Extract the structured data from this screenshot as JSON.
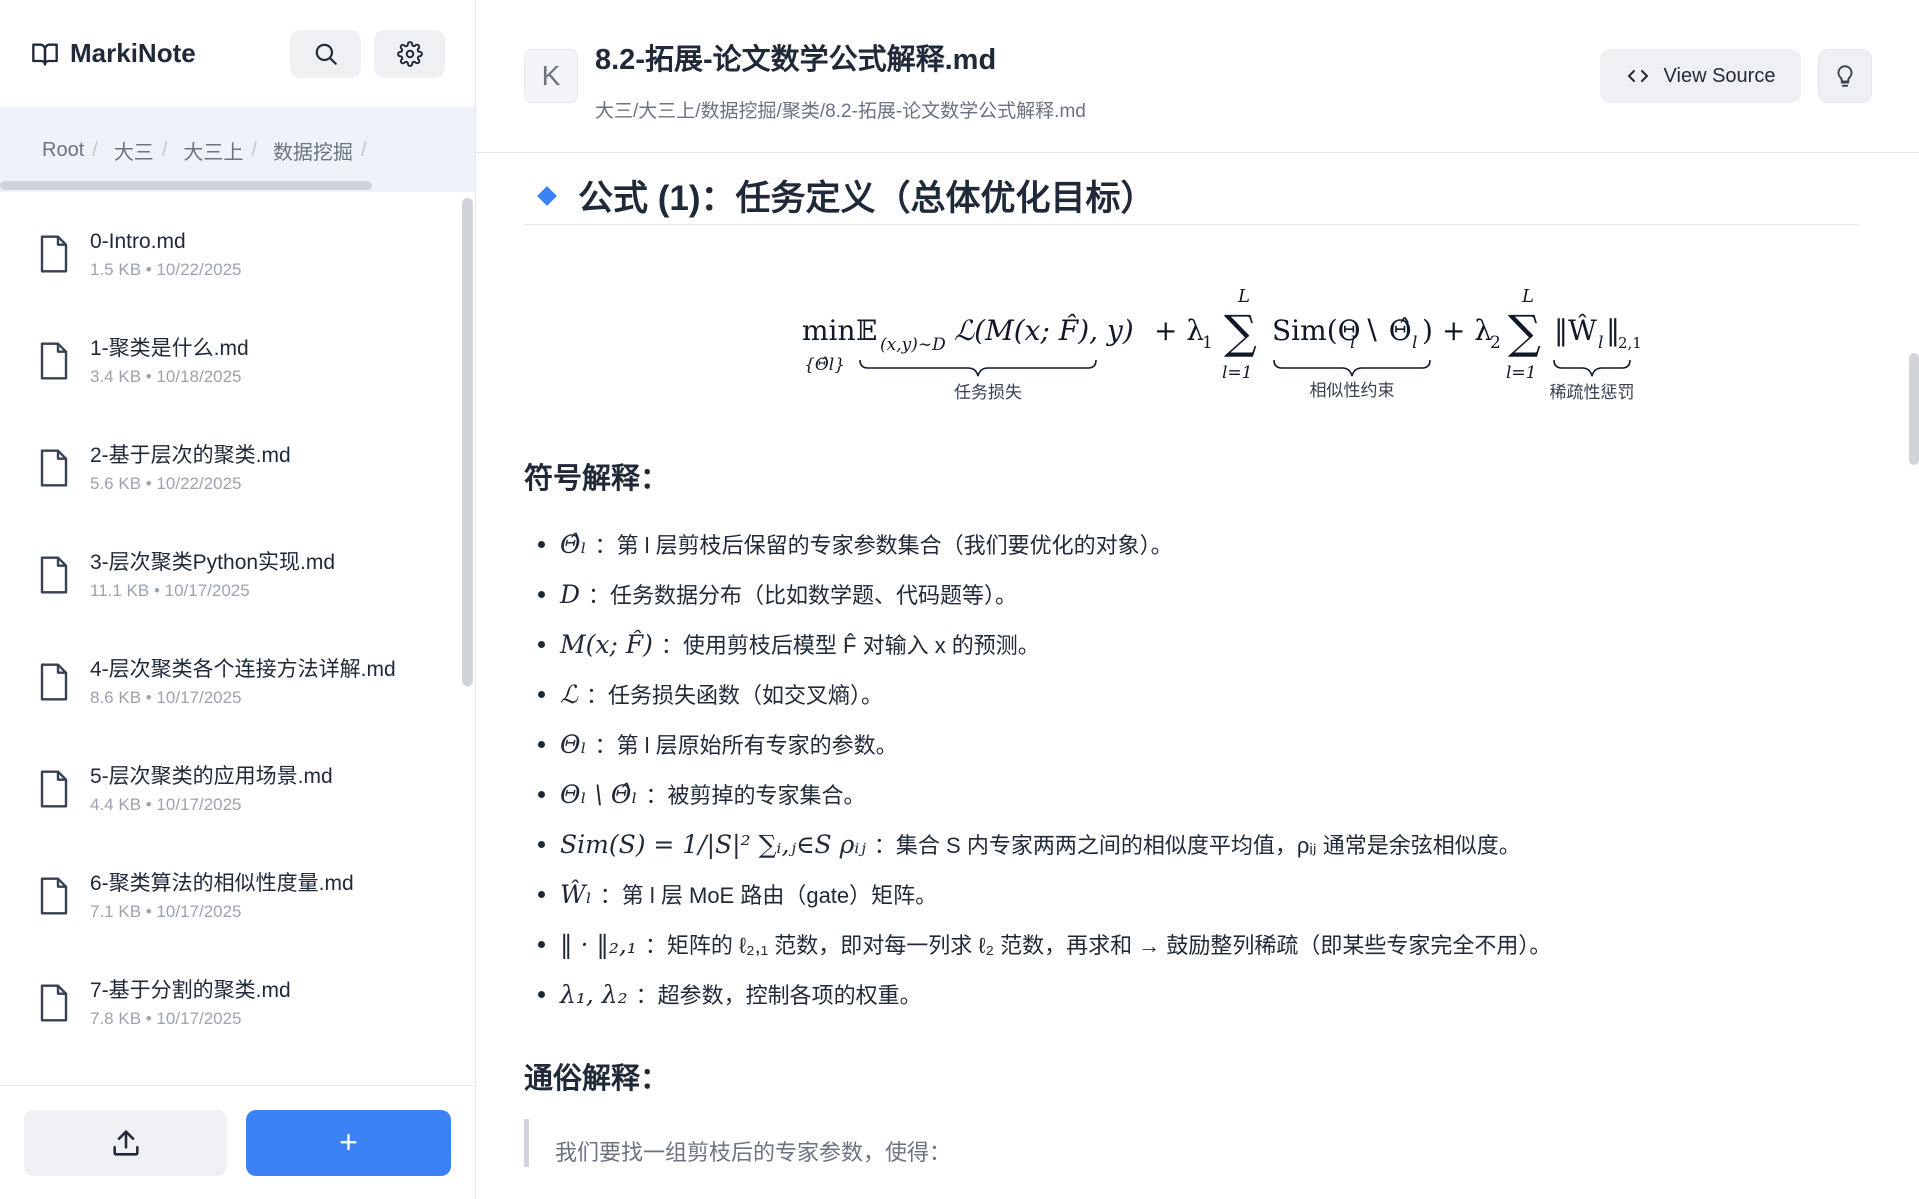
{
  "app": {
    "name": "MarkiNote"
  },
  "sidebar": {
    "breadcrumbs": [
      "Root",
      "大三",
      "大三上",
      "数据挖掘"
    ],
    "files": [
      {
        "name": "0-Intro.md",
        "meta": "1.5 KB • 10/22/2025"
      },
      {
        "name": "1-聚类是什么.md",
        "meta": "3.4 KB • 10/18/2025"
      },
      {
        "name": "2-基于层次的聚类.md",
        "meta": "5.6 KB • 10/22/2025"
      },
      {
        "name": "3-层次聚类Python实现.md",
        "meta": "11.1 KB • 10/17/2025"
      },
      {
        "name": "4-层次聚类各个连接方法详解.md",
        "meta": "8.6 KB • 10/17/2025"
      },
      {
        "name": "5-层次聚类的应用场景.md",
        "meta": "4.4 KB • 10/17/2025"
      },
      {
        "name": "6-聚类算法的相似性度量.md",
        "meta": "7.1 KB • 10/17/2025"
      },
      {
        "name": "7-基于分割的聚类.md",
        "meta": "7.8 KB • 10/17/2025"
      }
    ],
    "new_label": "+"
  },
  "header": {
    "collapse_label": "K",
    "title": "8.2-拓展-论文数学公式解释.md",
    "path": "大三/大三上/数据挖掘/聚类/8.2-拓展-论文数学公式解释.md",
    "view_source_label": "View Source"
  },
  "content": {
    "heading": "公式 (1)：任务定义（总体优化目标）",
    "formula_labels": {
      "task_loss": "任务损失",
      "similarity": "相似性约束",
      "sparsity": "稀疏性惩罚"
    },
    "symbols_heading": "符号解释：",
    "definitions": [
      {
        "math": "Θ̂ₗ",
        "text": "：第 l 层剪枝后保留的专家参数集合（我们要优化的对象）。"
      },
      {
        "math": "D",
        "text": "：任务数据分布（比如数学题、代码题等）。"
      },
      {
        "math": "M(x; F̂)",
        "text": "：使用剪枝后模型 F̂ 对输入 x 的预测。"
      },
      {
        "math": "ℒ",
        "text": "：任务损失函数（如交叉熵）。"
      },
      {
        "math": "Θₗ",
        "text": "：第 l 层原始所有专家的参数。"
      },
      {
        "math": "Θₗ \\ Θ̂ₗ",
        "text": "：被剪掉的专家集合。"
      },
      {
        "math": "Sim(S) = 1/|S|² ∑ᵢ,ⱼ∈S ρᵢⱼ",
        "text": "：集合 S 内专家两两之间的相似度平均值，ρᵢⱼ 通常是余弦相似度。"
      },
      {
        "math": "Ŵₗ",
        "text": "：第 l 层 MoE 路由（gate）矩阵。"
      },
      {
        "math": "‖ · ‖₂,₁",
        "text": "：矩阵的 ℓ₂,₁ 范数，即对每一列求 ℓ₂ 范数，再求和 → 鼓励整列稀疏（即某些专家完全不用）。"
      },
      {
        "math": "λ₁, λ₂",
        "text": "：超参数，控制各项的权重。"
      }
    ],
    "plain_heading": "通俗解释：",
    "quote_text": "我们要找一组剪枝后的专家参数，使得："
  }
}
